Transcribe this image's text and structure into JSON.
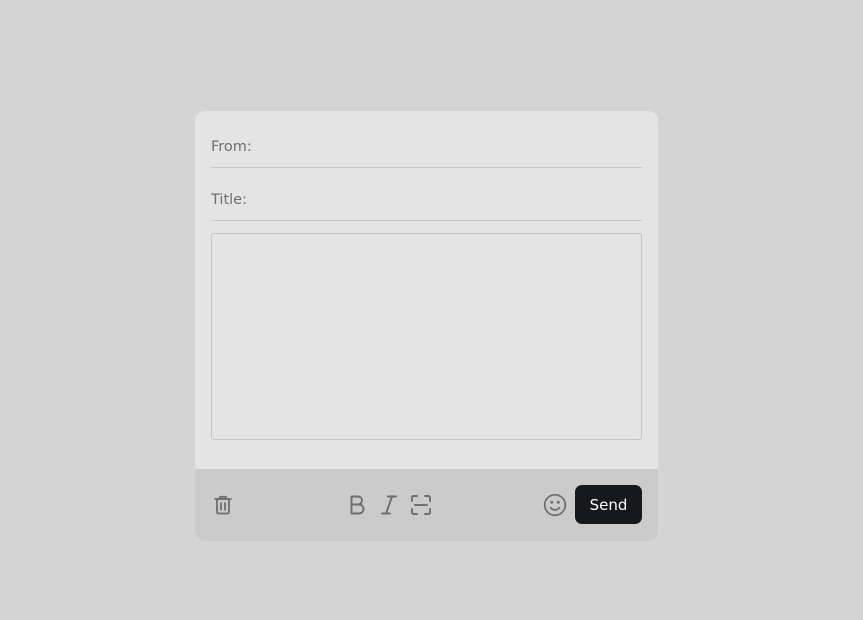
{
  "compose": {
    "from_label": "From:",
    "from_value": "",
    "title_label": "Title:",
    "title_value": "",
    "body_value": ""
  },
  "toolbar": {
    "icons": {
      "delete": "trash-icon",
      "bold": "bold-icon",
      "italic": "italic-icon",
      "code": "code-block-icon",
      "emoji": "smiley-icon"
    },
    "send_label": "Send"
  },
  "colors": {
    "page_background": "#d4d4d4",
    "card_background": "#e4e4e4",
    "toolbar_background": "#cbcbcb",
    "send_button": "#17181a",
    "icon_color": "#6e6e6e"
  }
}
